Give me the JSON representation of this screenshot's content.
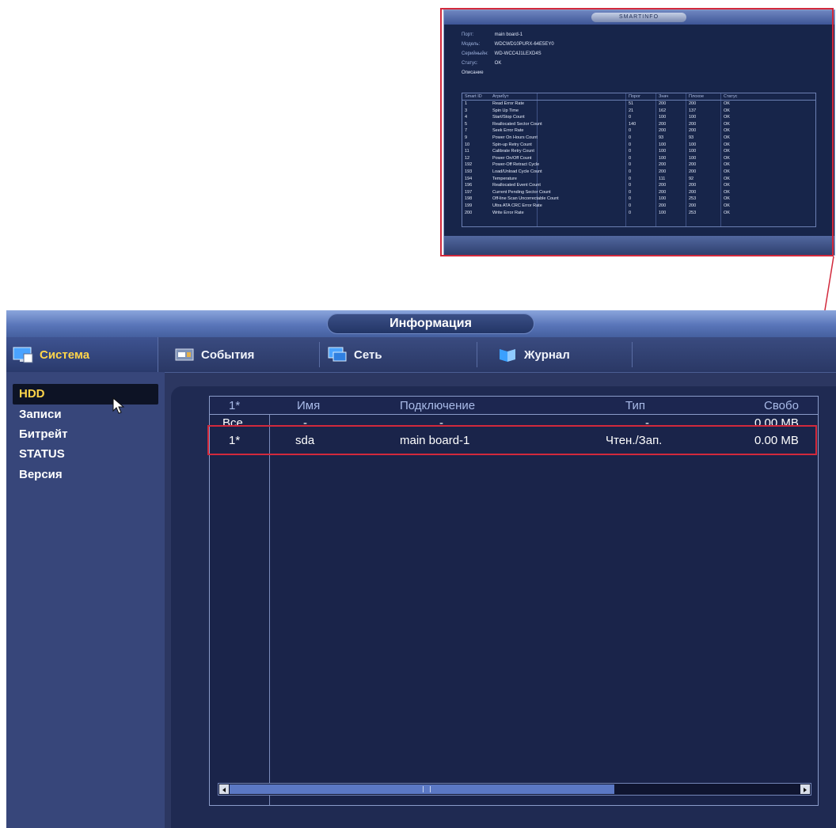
{
  "smart": {
    "title": "SMARTINFO",
    "port_label": "Порт:",
    "port": "main board-1",
    "model_label": "Модель:",
    "model": "WDCWD10PURX-64E5EY0",
    "serial_label": "Серийныйн:",
    "serial": "WD-WCC4J1LEXD4S",
    "status_label": "Статус:",
    "status": "OK",
    "desc_label": "Описание",
    "headers": [
      "Smart ID",
      "Атрибут",
      "Порог",
      "Знач",
      "Плохое",
      "Статус"
    ],
    "rows": [
      [
        "1",
        "Read Error Rate",
        "51",
        "200",
        "200",
        "OK"
      ],
      [
        "3",
        "Spin Up Time",
        "21",
        "162",
        "137",
        "OK"
      ],
      [
        "4",
        "Start/Stop Count",
        "0",
        "100",
        "100",
        "OK"
      ],
      [
        "5",
        "Reallocated Sector Count",
        "140",
        "200",
        "200",
        "OK"
      ],
      [
        "7",
        "Seek Error Rate",
        "0",
        "200",
        "200",
        "OK"
      ],
      [
        "9",
        "Power On Hours Count",
        "0",
        "93",
        "93",
        "OK"
      ],
      [
        "10",
        "Spin-up Retry Count",
        "0",
        "100",
        "100",
        "OK"
      ],
      [
        "11",
        "Calibrate Retry Count",
        "0",
        "100",
        "100",
        "OK"
      ],
      [
        "12",
        "Power On/Off Count",
        "0",
        "100",
        "100",
        "OK"
      ],
      [
        "192",
        "Power-Off Retract Cycle",
        "0",
        "200",
        "200",
        "OK"
      ],
      [
        "193",
        "Load/Unload Cycle Count",
        "0",
        "200",
        "200",
        "OK"
      ],
      [
        "194",
        "Temperature",
        "0",
        "111",
        "92",
        "OK"
      ],
      [
        "196",
        "Reallocated Event Count",
        "0",
        "200",
        "200",
        "OK"
      ],
      [
        "197",
        "Current Pending Sector Count",
        "0",
        "200",
        "200",
        "OK"
      ],
      [
        "198",
        "Off-line Scan Uncorrectable Count",
        "0",
        "100",
        "253",
        "OK"
      ],
      [
        "199",
        "Ultra ATA CRC Error Rate",
        "0",
        "200",
        "200",
        "OK"
      ],
      [
        "200",
        "Write Error Rate",
        "0",
        "100",
        "253",
        "OK"
      ]
    ]
  },
  "main": {
    "title": "Информация",
    "tabs": [
      "Система",
      "События",
      "Сеть",
      "Журнал"
    ],
    "menu": [
      "HDD",
      "Записи",
      "Битрейт",
      "STATUS",
      "Версия"
    ],
    "active_menu": "HDD",
    "table": {
      "headers": [
        "1*",
        "Имя",
        "Подключение",
        "Тип",
        "Свобо"
      ],
      "rows": [
        [
          "Все",
          "-",
          "-",
          "-",
          "0.00 MB"
        ],
        [
          "1*",
          "sda",
          "main board-1",
          "Чтен./Зап.",
          "0.00 MB"
        ]
      ]
    }
  },
  "colors": {
    "highlight_red": "#d2293c",
    "active_text": "#ffd54a",
    "panel_bg": "#2c3761"
  }
}
